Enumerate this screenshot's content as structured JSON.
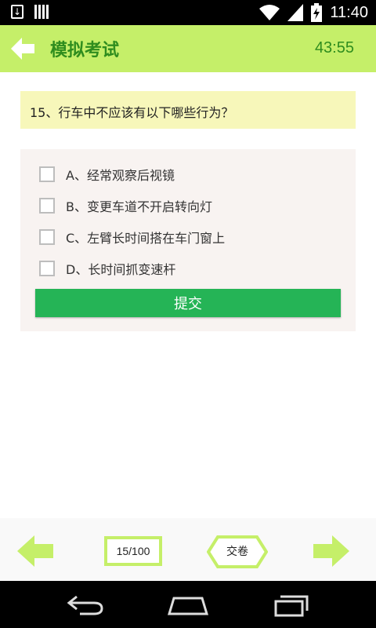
{
  "status_bar": {
    "time": "11:40",
    "icons": [
      "download-icon",
      "bars-icon",
      "wifi-icon",
      "signal-icon",
      "battery-charging-icon"
    ]
  },
  "header": {
    "title": "模拟考试",
    "timer": "43:55",
    "back_icon": "back-arrow-icon",
    "accent_color": "#c5ef69",
    "text_color": "#2f8d1e"
  },
  "question": {
    "text": "15、行车中不应该有以下哪些行为？",
    "options": [
      {
        "label": "A、经常观察后视镜",
        "checked": false
      },
      {
        "label": "B、变更车道不开启转向灯",
        "checked": false
      },
      {
        "label": "C、左臂长时间搭在车门窗上",
        "checked": false
      },
      {
        "label": "D、长时间抓变速杆",
        "checked": false
      }
    ],
    "submit_label": "提交",
    "submit_color": "#25b456"
  },
  "bottom_nav": {
    "prev_icon": "prev-arrow-icon",
    "page_counter": "15/100",
    "submit_exam_label": "交卷",
    "next_icon": "next-arrow-icon"
  },
  "system_nav": {
    "icons": [
      "nav-back-icon",
      "nav-home-icon",
      "nav-recent-icon"
    ]
  }
}
